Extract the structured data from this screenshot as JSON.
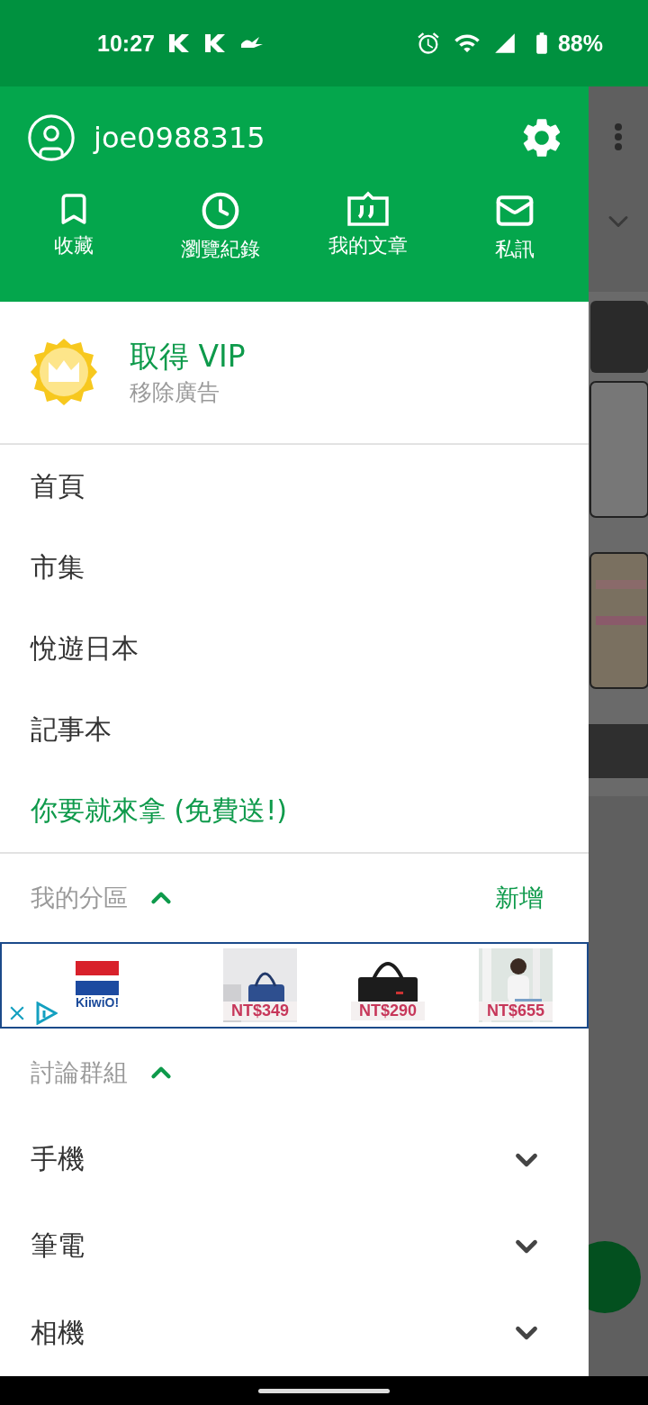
{
  "status_bar": {
    "time": "10:27",
    "battery": "88%"
  },
  "drawer": {
    "user": {
      "name": "joe0988315"
    },
    "shortcuts": [
      {
        "label": "收藏",
        "kind": "bookmark"
      },
      {
        "label": "瀏覽紀錄",
        "kind": "history"
      },
      {
        "label": "我的文章",
        "kind": "posts"
      },
      {
        "label": "私訊",
        "kind": "mail"
      }
    ],
    "vip": {
      "title": "取得 VIP",
      "subtitle": "移除廣告"
    },
    "menu": [
      {
        "label": "首頁",
        "highlighted": false
      },
      {
        "label": "市集",
        "highlighted": false
      },
      {
        "label": "悅遊日本",
        "highlighted": false
      },
      {
        "label": "記事本",
        "highlighted": false
      },
      {
        "label": "你要就來拿 (免費送!)",
        "highlighted": true
      }
    ],
    "my_sections": {
      "title": "我的分區",
      "expanded": true,
      "action": "新增"
    },
    "ad": {
      "brand": "KiiwiO!",
      "products": [
        {
          "price": "NT$349"
        },
        {
          "price": "NT$290"
        },
        {
          "price": "NT$655"
        }
      ]
    },
    "groups": {
      "title": "討論群組",
      "expanded": true,
      "items": [
        {
          "label": "手機",
          "expanded": false
        },
        {
          "label": "筆電",
          "expanded": false
        },
        {
          "label": "相機",
          "expanded": false
        }
      ]
    }
  }
}
